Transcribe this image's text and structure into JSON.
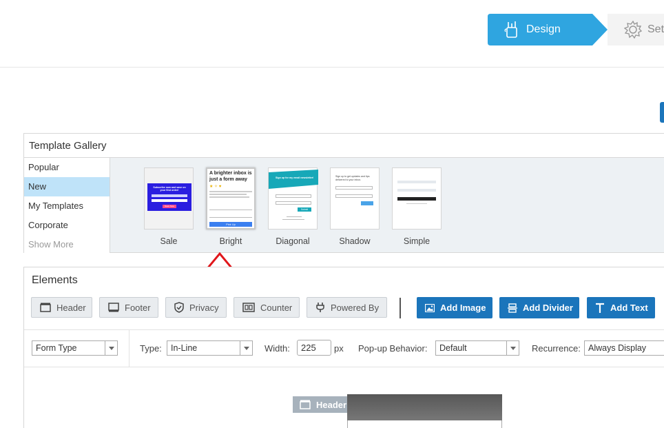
{
  "stepper": {
    "design_label": "Design",
    "setup_label": "Set",
    "design_color": "#2fa5e0"
  },
  "gallery": {
    "title": "Template Gallery",
    "categories": [
      "Popular",
      "New",
      "My Templates",
      "Corporate"
    ],
    "show_more": "Show More",
    "templates": [
      {
        "name": "Sale"
      },
      {
        "name": "Bright",
        "preview_title": "A brighter inbox is just a form away",
        "preview_button": "Pick Up"
      },
      {
        "name": "Diagonal",
        "preview_title": "Sign up for my email newsletter!",
        "preview_button": "Submit"
      },
      {
        "name": "Shadow",
        "preview_title": "Sign up to get updates and tips delivered to your inbox."
      },
      {
        "name": "Simple"
      }
    ],
    "sale_preview": {
      "title": "Subscribe now and save on your first order!",
      "button": "Save Now"
    }
  },
  "elements": {
    "title": "Elements",
    "buttons": [
      "Header",
      "Footer",
      "Privacy",
      "Counter",
      "Powered By"
    ],
    "add_buttons": [
      "Add Image",
      "Add Divider",
      "Add Text"
    ],
    "options": {
      "form_type": "Form Type",
      "type_label": "Type:",
      "type_value": "In-Line",
      "width_label": "Width:",
      "width_value": "225",
      "width_unit": "px",
      "popup_label": "Pop-up Behavior:",
      "popup_value": "Default",
      "recurrence_label": "Recurrence:",
      "recurrence_value": "Always Display"
    },
    "canvas_header_label": "Header"
  },
  "colors": {
    "accent_blue": "#1b75bb",
    "active_category": "#bfe3f9",
    "annotation_red": "#e0161b"
  }
}
